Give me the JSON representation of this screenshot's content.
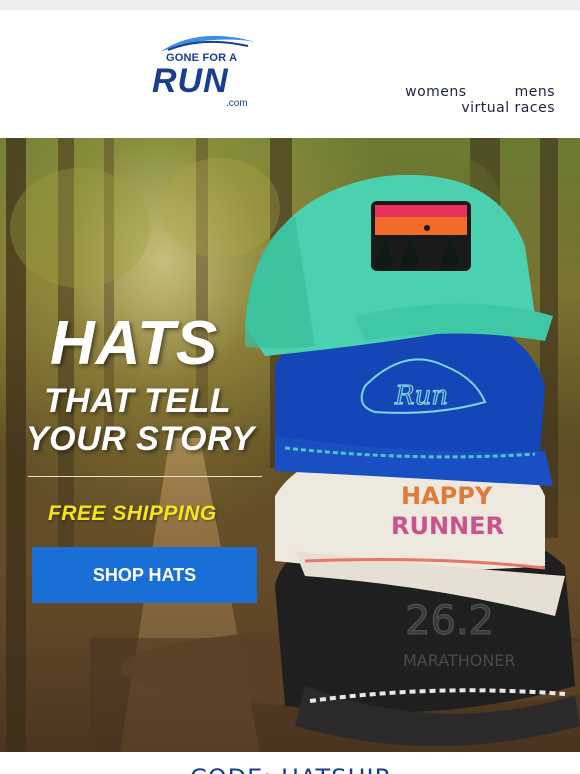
{
  "logo": {
    "top_text": "GONE FOR A",
    "main_text": "RUN",
    "suffix": ".com"
  },
  "nav": {
    "womens": "womens",
    "mens": "mens",
    "virtual_races": "virtual races"
  },
  "hero": {
    "title_line1": "HATS",
    "title_line2": "THAT TELL",
    "title_line3": "YOUR STORY",
    "shipping": "FREE SHIPPING",
    "button_label": "SHOP HATS",
    "hat_run_text": "Run",
    "hat_happy_line1": "HAPPY",
    "hat_happy_line2": "RUNNER",
    "hat_marathon_number": "26.2",
    "hat_marathon_text": "MARATHONER"
  },
  "promo": {
    "code_text": "CODE: HATSHIP"
  },
  "colors": {
    "brand_blue": "#1a3e8f",
    "button_blue": "#1a6fd6",
    "shipping_yellow": "#f5e61a"
  }
}
